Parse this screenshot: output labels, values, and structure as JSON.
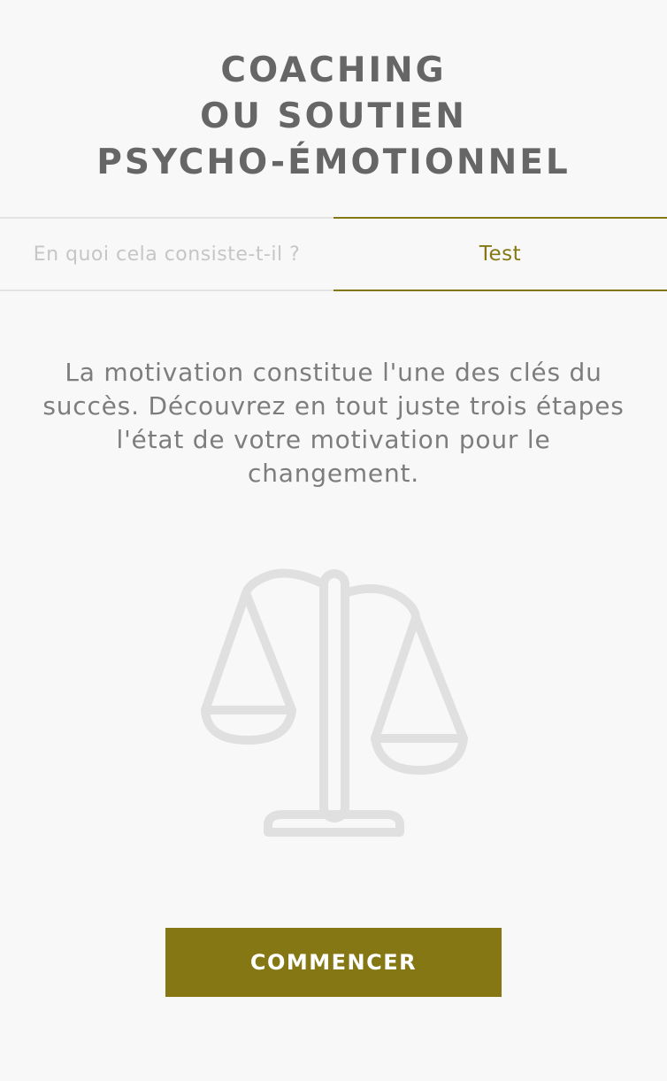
{
  "header": {
    "title_lines": [
      "COACHING",
      "OU SOUTIEN",
      "PSYCHO-ÉMOTIONNEL"
    ]
  },
  "tabs": [
    {
      "label": "En quoi cela consiste-t-il ?",
      "active": false
    },
    {
      "label": "Test",
      "active": true
    }
  ],
  "main": {
    "description": "La motivation constitue l'une des clés du succès. Découvrez en tout juste trois étapes l'état de votre motivation pour le changement.",
    "illustration": "balance-scale-icon",
    "start_label": "COMMENCER"
  },
  "colors": {
    "accent": "#857713",
    "background": "#f8f8f8",
    "title": "#666666",
    "text": "#7d7d7d",
    "inactive_tab": "#c6c6c6",
    "icon": "#e0e0e0"
  }
}
